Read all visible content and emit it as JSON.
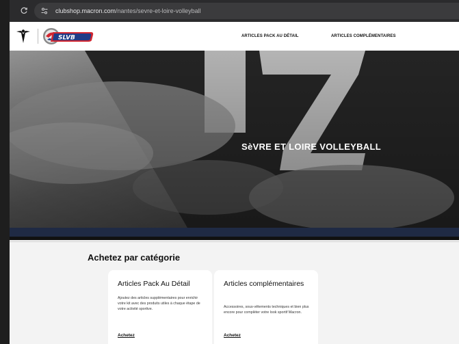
{
  "browser": {
    "url_host": "clubshop.macron.com",
    "url_path": "/nantes/sevre-et-loire-volleyball"
  },
  "header": {
    "nav": [
      {
        "label": "ARTICLES PACK AU DÉTAIL"
      },
      {
        "label": "ARTICLES COMPLÉMENTAIRES"
      }
    ]
  },
  "hero": {
    "title": "SèVRE ET LOIRE VOLLEYBALL"
  },
  "main": {
    "section_title": "Achetez par catégorie",
    "cards": [
      {
        "title": "Articles Pack Au Détail",
        "description": "Ajoutez des articles supplémentaires pour enrichir votre kit avec des produits utiles à chaque étape de votre activité sportive.",
        "link": "Achetez"
      },
      {
        "title": "Articles complémentaires",
        "description": "Accessoires, sous-vêtements techniques et bien plus encore pour compléter votre look sportif Macron.",
        "link": "Achetez"
      }
    ]
  },
  "colors": {
    "browser_bg": "#2b2b2d",
    "header_bg": "#ffffff",
    "hero_band": "#1f2a44",
    "page_bg": "#f3f3f3",
    "club_red": "#d22630",
    "club_blue": "#1f3c88"
  },
  "icons": {
    "reload": "reload-icon",
    "site_info": "site-info-icon",
    "brand": "macron-logo",
    "club": "slvb-logo"
  }
}
